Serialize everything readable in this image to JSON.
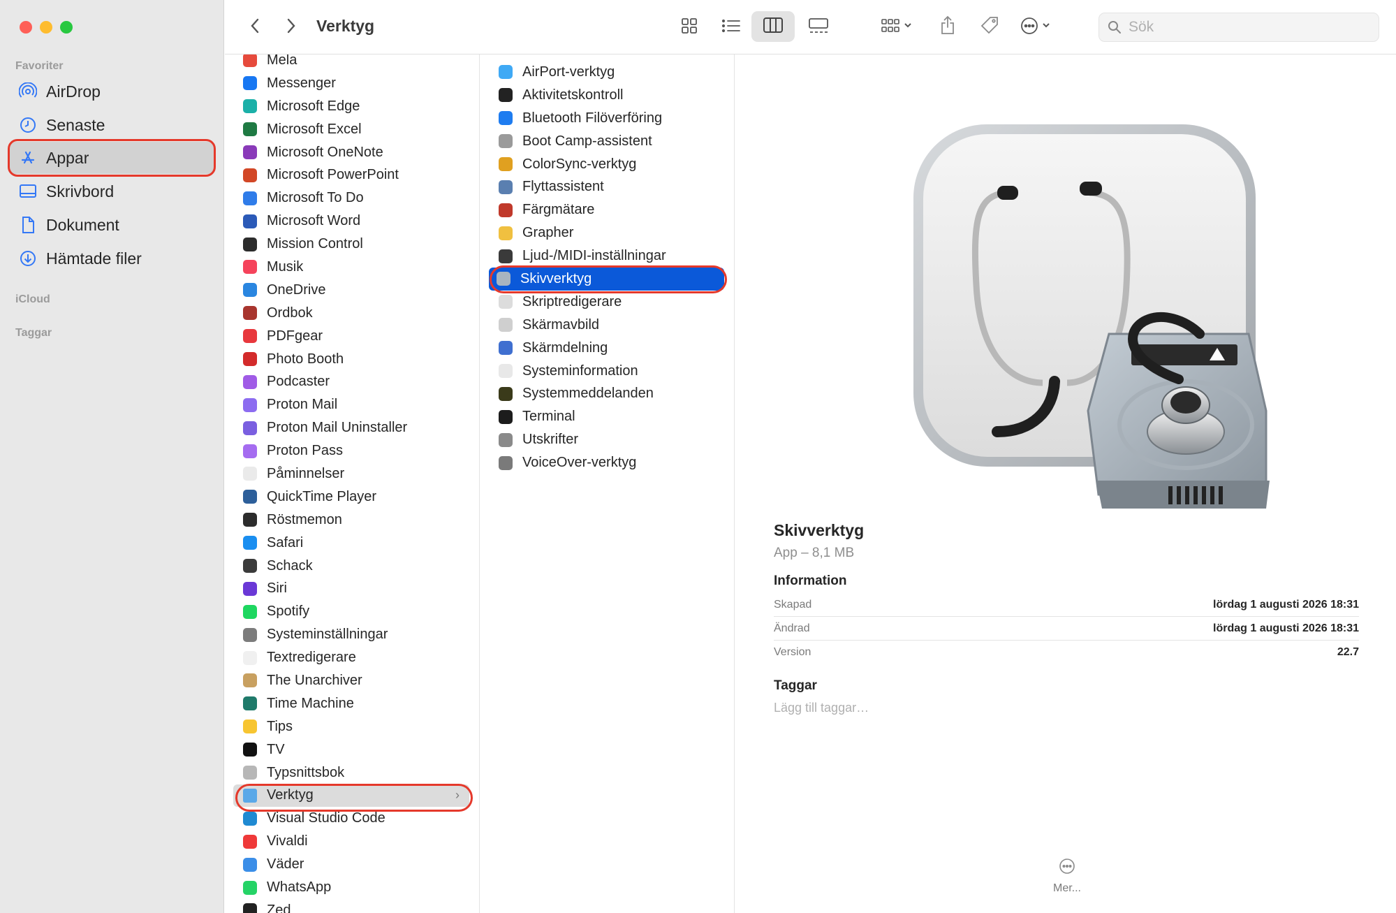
{
  "window": {
    "title": "Verktyg"
  },
  "sidebar": {
    "favorites_heading": "Favoriter",
    "items": [
      {
        "label": "AirDrop",
        "icon": "airdrop-icon"
      },
      {
        "label": "Senaste",
        "icon": "clock-icon"
      },
      {
        "label": "Appar",
        "icon": "apps-icon",
        "selected": true
      },
      {
        "label": "Skrivbord",
        "icon": "desktop-icon"
      },
      {
        "label": "Dokument",
        "icon": "document-icon"
      },
      {
        "label": "Hämtade filer",
        "icon": "download-icon"
      }
    ],
    "icloud_heading": "iCloud",
    "tags_heading": "Taggar"
  },
  "toolbar": {
    "title": "Verktyg",
    "search_placeholder": "Sök",
    "buttons": [
      "back-icon",
      "forward-icon",
      "icon-view-icon",
      "list-view-icon",
      "column-view-icon",
      "gallery-view-icon",
      "group-icon",
      "share-icon",
      "tag-icon",
      "more-actions-icon"
    ],
    "active_view": "column-view"
  },
  "apps_column": {
    "items": [
      {
        "name": "Mela",
        "color": "#e64a3c"
      },
      {
        "name": "Messenger",
        "color": "#1877f2"
      },
      {
        "name": "Microsoft Edge",
        "color": "#1bb0a8"
      },
      {
        "name": "Microsoft Excel",
        "color": "#1f7a43"
      },
      {
        "name": "Microsoft OneNote",
        "color": "#8a3ab9"
      },
      {
        "name": "Microsoft PowerPoint",
        "color": "#d24726"
      },
      {
        "name": "Microsoft To Do",
        "color": "#2f7ce9"
      },
      {
        "name": "Microsoft Word",
        "color": "#2b5ab8"
      },
      {
        "name": "Mission Control",
        "color": "#2c2c2c"
      },
      {
        "name": "Musik",
        "color": "#f5435b"
      },
      {
        "name": "OneDrive",
        "color": "#2a86e0"
      },
      {
        "name": "Ordbok",
        "color": "#a8352e"
      },
      {
        "name": "PDFgear",
        "color": "#e8383d"
      },
      {
        "name": "Photo Booth",
        "color": "#d32b2b"
      },
      {
        "name": "Podcaster",
        "color": "#a05be6"
      },
      {
        "name": "Proton Mail",
        "color": "#8c6cf0"
      },
      {
        "name": "Proton Mail Uninstaller",
        "color": "#7a5fe0"
      },
      {
        "name": "Proton Pass",
        "color": "#a56cf0"
      },
      {
        "name": "Påminnelser",
        "color": "#eaeaea"
      },
      {
        "name": "QuickTime Player",
        "color": "#2d5f9a"
      },
      {
        "name": "Röstmemon",
        "color": "#2c2c2c"
      },
      {
        "name": "Safari",
        "color": "#1a8ef0"
      },
      {
        "name": "Schack",
        "color": "#3b3b3b"
      },
      {
        "name": "Siri",
        "color": "#6a38d6"
      },
      {
        "name": "Spotify",
        "color": "#1ed760"
      },
      {
        "name": "Systeminställningar",
        "color": "#7c7c7c"
      },
      {
        "name": "Textredigerare",
        "color": "#f0f0f0"
      },
      {
        "name": "The Unarchiver",
        "color": "#c8a060"
      },
      {
        "name": "Time Machine",
        "color": "#1f7a6a"
      },
      {
        "name": "Tips",
        "color": "#f7c531"
      },
      {
        "name": "TV",
        "color": "#111111"
      },
      {
        "name": "Typsnittsbok",
        "color": "#b7b7b7"
      },
      {
        "name": "Verktyg",
        "color": "#5aa8e8",
        "selected": true,
        "folder": true
      },
      {
        "name": "Visual Studio Code",
        "color": "#1f8ad2"
      },
      {
        "name": "Vivaldi",
        "color": "#ef3939"
      },
      {
        "name": "Väder",
        "color": "#3b8ee8"
      },
      {
        "name": "WhatsApp",
        "color": "#25d366"
      },
      {
        "name": "Zed",
        "color": "#222222"
      }
    ]
  },
  "utilities_column": {
    "items": [
      {
        "name": "AirPort-verktyg",
        "color": "#3fa9f5"
      },
      {
        "name": "Aktivitetskontroll",
        "color": "#222222"
      },
      {
        "name": "Bluetooth Filöverföring",
        "color": "#1e7cf0"
      },
      {
        "name": "Boot Camp-assistent",
        "color": "#9a9a9a"
      },
      {
        "name": "ColorSync-verktyg",
        "color": "#e0a020"
      },
      {
        "name": "Flyttassistent",
        "color": "#5a7fb0"
      },
      {
        "name": "Färgmätare",
        "color": "#c0392b"
      },
      {
        "name": "Grapher",
        "color": "#f0c040"
      },
      {
        "name": "Ljud-/MIDI-inställningar",
        "color": "#3a3a3a"
      },
      {
        "name": "Skivverktyg",
        "color": "#a8b4c0",
        "selected": true
      },
      {
        "name": "Skriptredigerare",
        "color": "#dcdcdc"
      },
      {
        "name": "Skärmavbild",
        "color": "#cfcfcf"
      },
      {
        "name": "Skärmdelning",
        "color": "#3f6fd0"
      },
      {
        "name": "Systeminformation",
        "color": "#e8e8e8"
      },
      {
        "name": "Systemmeddelanden",
        "color": "#3a3a1a"
      },
      {
        "name": "Terminal",
        "color": "#1c1c1c"
      },
      {
        "name": "Utskrifter",
        "color": "#8a8a8a"
      },
      {
        "name": "VoiceOver-verktyg",
        "color": "#7a7a7a"
      }
    ]
  },
  "preview": {
    "name": "Skivverktyg",
    "kind": "App – 8,1 MB",
    "info_heading": "Information",
    "info": [
      {
        "key": "Skapad",
        "value": "lördag 1 augusti 2026 18:31"
      },
      {
        "key": "Ändrad",
        "value": "lördag 1 augusti 2026 18:31"
      },
      {
        "key": "Version",
        "value": "22.7"
      }
    ],
    "tags_heading": "Taggar",
    "tags_placeholder": "Lägg till taggar…",
    "more_label": "Mer..."
  }
}
